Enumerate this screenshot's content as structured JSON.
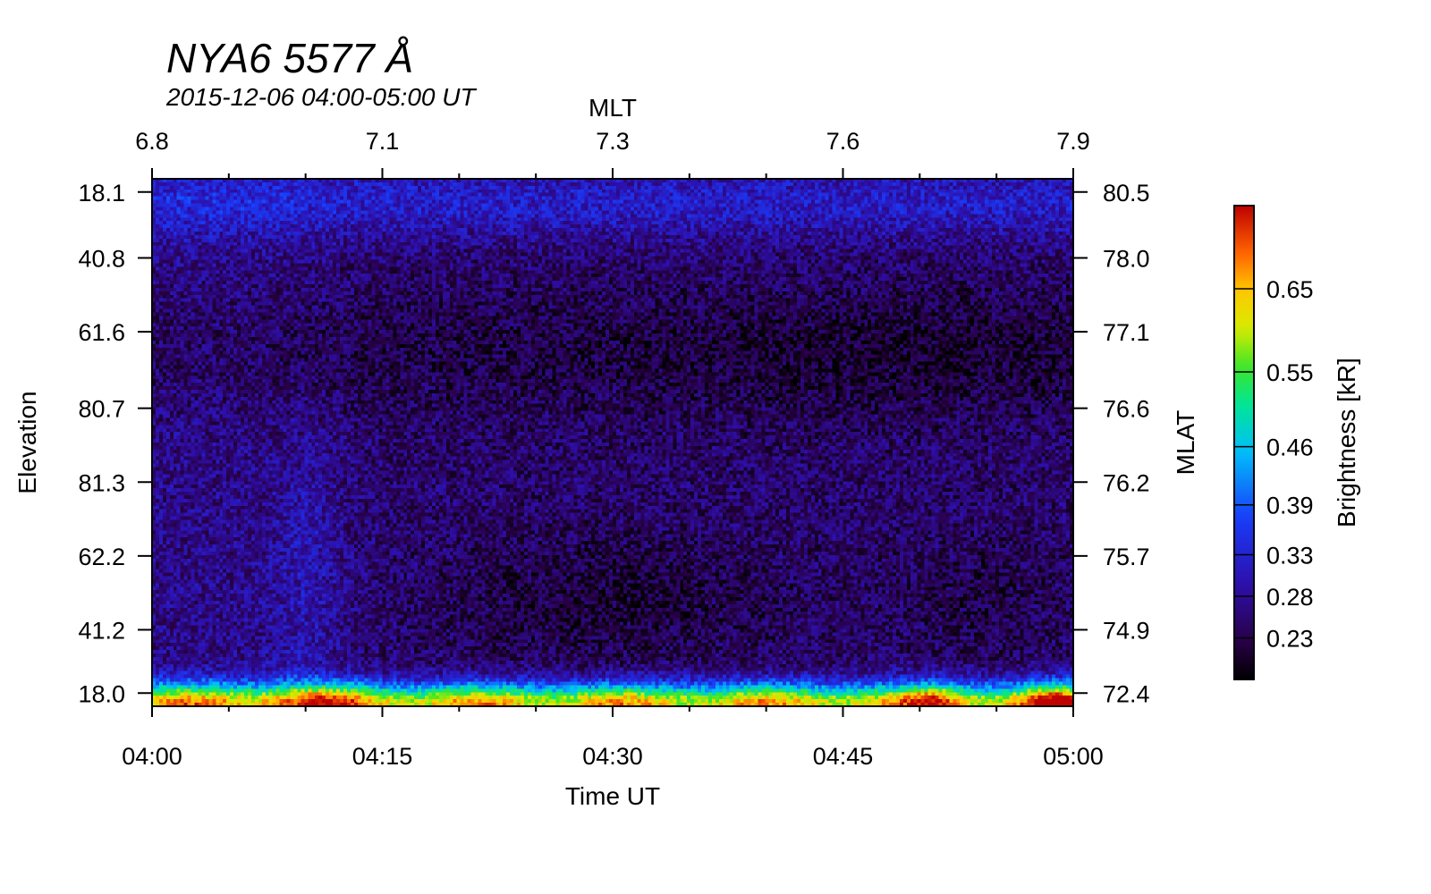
{
  "title": "NYA6 5577 Å",
  "subtitle": "2015-12-06 04:00-05:00 UT",
  "chart_data": {
    "type": "heatmap",
    "title": "NYA6 5577 Å",
    "subtitle": "2015-12-06 04:00-05:00 UT",
    "xlabel": "Time UT",
    "x_ticks": [
      "04:00",
      "04:15",
      "04:30",
      "04:45",
      "05:00"
    ],
    "x_range": [
      "04:00",
      "05:00"
    ],
    "top_axis": {
      "label": "MLT",
      "ticks": [
        "6.8",
        "7.1",
        "7.3",
        "7.6",
        "7.9"
      ]
    },
    "ylabel": "Elevation",
    "y_ticks": [
      "18.1",
      "40.8",
      "61.6",
      "80.7",
      "81.3",
      "62.2",
      "41.2",
      "18.0"
    ],
    "right_axis": {
      "label": "MLAT",
      "ticks": [
        "80.5",
        "78.0",
        "77.1",
        "76.6",
        "76.2",
        "75.7",
        "74.9",
        "72.4"
      ]
    },
    "colorbar": {
      "label": "Brightness [kR]",
      "ticks": [
        "0.65",
        "0.55",
        "0.46",
        "0.39",
        "0.33",
        "0.28",
        "0.23"
      ],
      "min": 0.18,
      "max": 0.75
    },
    "description_values": {
      "background_level_kR": 0.25,
      "dark_band_level_kR": 0.21,
      "bottom_edge_level_kR": 0.68,
      "bright_column_time": "04:10"
    }
  }
}
